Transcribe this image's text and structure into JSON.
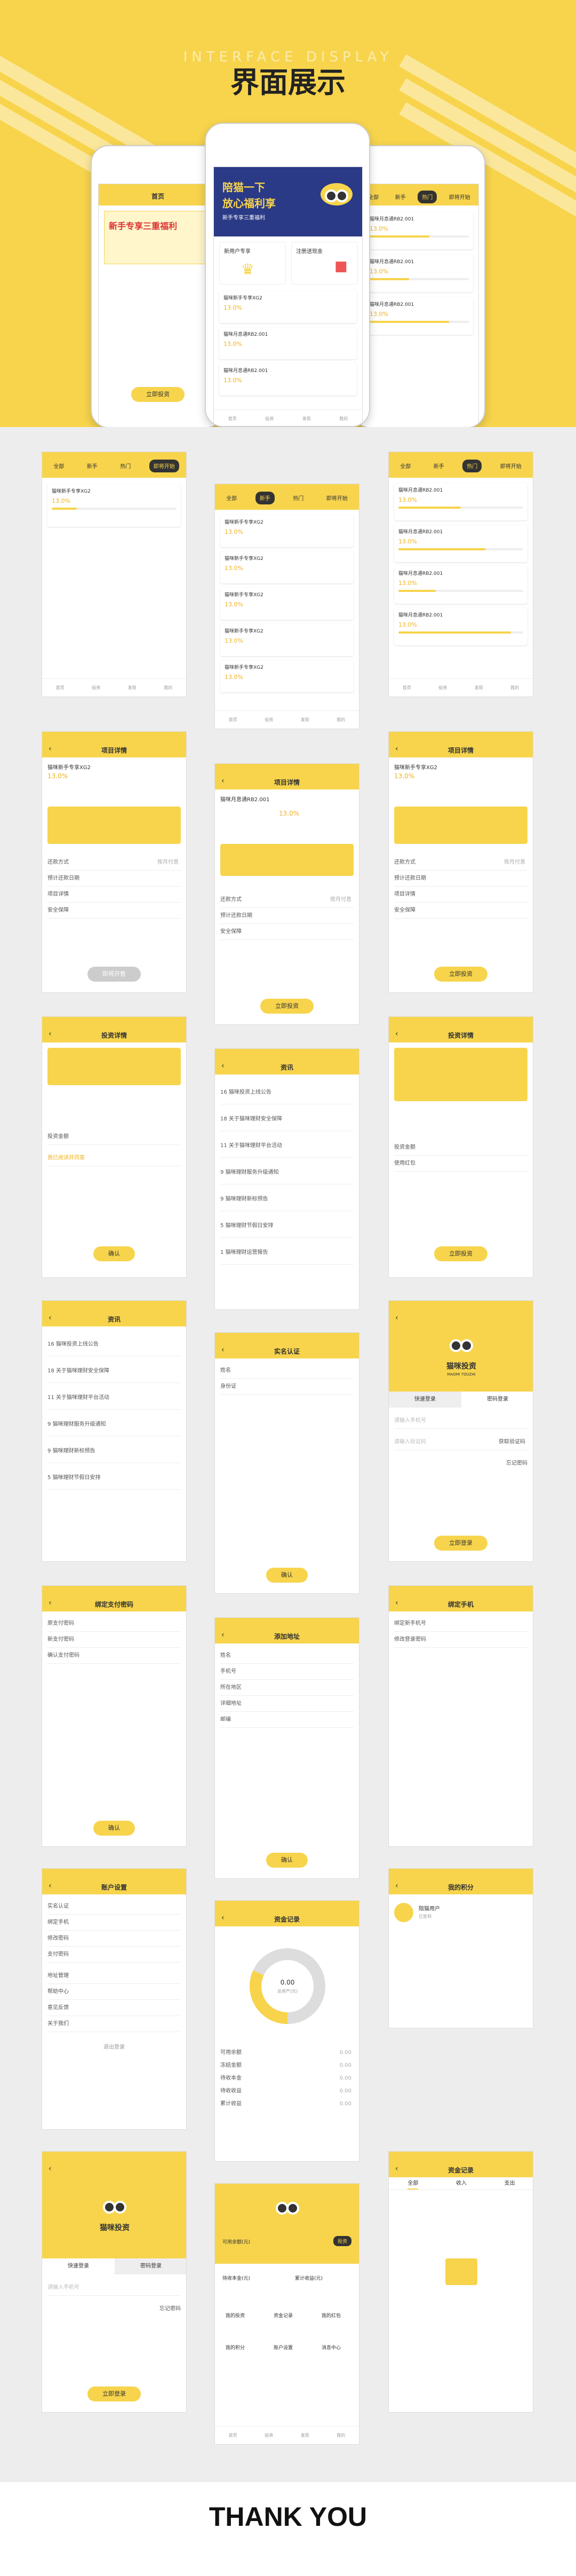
{
  "hero": {
    "subtitle": "INTERFACE DISPLAY",
    "title": "界面展示"
  },
  "footer": {
    "thanks": "THANK YOU"
  },
  "tabs": [
    "全部",
    "新手",
    "热门",
    "即将开始"
  ],
  "nav_bar": [
    "首页",
    "投资",
    "发现",
    "我的"
  ],
  "projects": {
    "name_a": "猫咪新手专享XG2",
    "name_b": "猫咪月息通RB2.001",
    "rate": "13.0%",
    "rate_label": "预期年化收益",
    "invest_btn": "立即投资",
    "tag_new": "新手"
  },
  "banner": {
    "line1": "陪猫一下",
    "line2": "放心福利享",
    "sub": "新手专享三重福利"
  },
  "home": {
    "newbie": "新用户专享",
    "cash": "注册送现金"
  },
  "detail": {
    "title": "项目详情",
    "repay_way": "还款方式",
    "repay_val": "按月付息",
    "start_date": "预计还款日期",
    "desc": "项目详情",
    "safety": "安全保障",
    "btn_soon": "即将开售",
    "btn_invest": "立即投资"
  },
  "invest": {
    "title": "投资详情",
    "amount_label": "投资金额",
    "coupon": "使用红包",
    "agree": "我已阅读并同意",
    "confirm": "确认",
    "pay_now": "立即投资"
  },
  "news": {
    "title": "资讯",
    "items": [
      "猫咪投资上线公告",
      "关于猫咪理财安全保障",
      "关于猫咪理财平台活动",
      "猫咪理财服务升级通知",
      "猫咪理财新标预告",
      "猫咪理财节假日安排",
      "猫咪理财运营报告"
    ],
    "days": [
      "16",
      "18",
      "11",
      "9",
      "9",
      "5",
      "1"
    ]
  },
  "realname": {
    "title": "实名认证",
    "name": "姓名",
    "id": "身份证",
    "confirm": "确认"
  },
  "login": {
    "brand": "猫咪投资",
    "brand_en": "MAOMI TOUZHI",
    "tab_quick": "快速登录",
    "tab_pwd": "密码登录",
    "phone_ph": "请输入手机号",
    "code_ph": "请输入验证码",
    "captcha": "获取验证码",
    "forgot": "忘记密码",
    "btn": "立即登录"
  },
  "paypwd": {
    "title": "绑定支付密码",
    "old": "原支付密码",
    "new": "新支付密码",
    "again": "确认支付密码",
    "btn": "确认"
  },
  "bindphone": {
    "title": "绑定手机",
    "r1": "绑定新手机号",
    "r2": "修改登录密码"
  },
  "address": {
    "title": "添加地址",
    "fields": [
      "姓名",
      "手机号",
      "所在地区",
      "详细地址",
      "邮编"
    ],
    "btn": "确认"
  },
  "account": {
    "title": "账户设置",
    "rows": [
      "实名认证",
      "绑定手机",
      "修改密码",
      "支付密码",
      "地址管理",
      "帮助中心",
      "意见反馈",
      "关于我们"
    ],
    "logout": "退出登录"
  },
  "assets": {
    "title": "资金记录",
    "total_label": "总资产(元)",
    "total": "0.00",
    "legend": [
      "可用余额",
      "冻结金额",
      "待收本金",
      "待收收益",
      "累计收益"
    ],
    "legend_vals": [
      "0.00",
      "0.00",
      "0.00",
      "0.00",
      "0.00"
    ]
  },
  "points": {
    "title": "我的积分",
    "user": "陪猫用户",
    "sub": "已签到"
  },
  "login2": {
    "btn": "立即登录"
  },
  "mine": {
    "available": "可用余额(元)",
    "invest": "投资",
    "r1": "待收本金(元)",
    "r2": "累计收益(元)",
    "grid": [
      "我的投资",
      "资金记录",
      "我的红包",
      "我的积分",
      "账户设置",
      "消息中心"
    ]
  },
  "redpack": {
    "title": "资金记录",
    "tabs": [
      "全部",
      "收入",
      "支出"
    ]
  },
  "colors": {
    "brand": "#f7d44c",
    "accent": "#f0b21e",
    "dark": "#333333"
  }
}
